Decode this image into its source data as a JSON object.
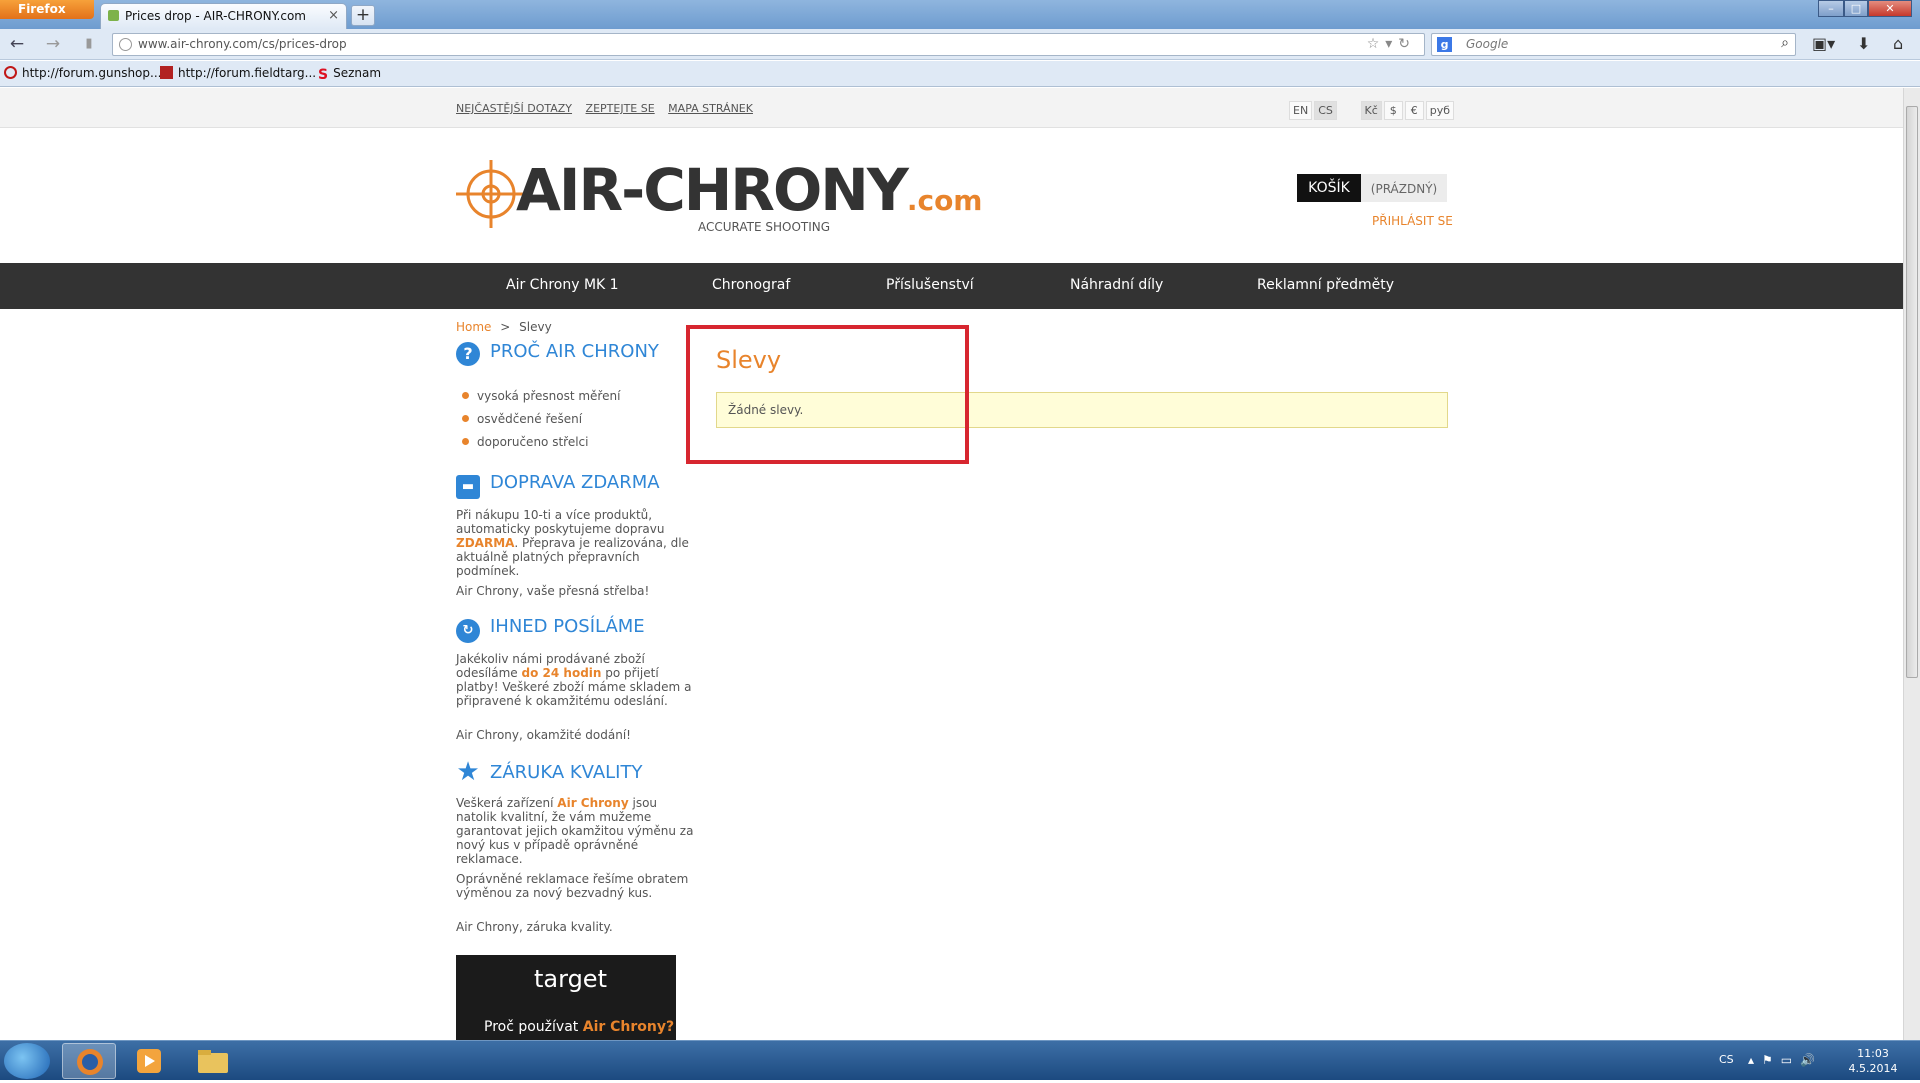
{
  "browser": {
    "app_menu": "Firefox",
    "tab_title": "Prices drop - AIR-CHRONY.com",
    "url": "www.air-chrony.com/cs/prices-drop",
    "search_placeholder": "Google",
    "bookmarks": [
      "http://forum.gunshop...",
      "http://forum.fieldtarg...",
      "Seznam"
    ]
  },
  "site": {
    "top_links": [
      "NEJČASTĚJŠÍ DOTAZY",
      "ZEPTEJTE SE",
      "MAPA STRÁNEK"
    ],
    "languages": [
      "EN",
      "CS"
    ],
    "currencies": [
      "Kč",
      "$",
      "€",
      "руб"
    ],
    "logo_text": "AIR-CHRONY",
    "logo_tld": ".com",
    "logo_sub": "ACCURATE SHOOTING",
    "cart_label": "KOŠÍK",
    "cart_value": "(PRÁZDNÝ)",
    "login": "PŘIHLÁSIT SE",
    "nav": [
      "Air Chrony MK 1",
      "Chronograf",
      "Příslušenství",
      "Náhradní díly",
      "Reklamní předměty"
    ],
    "breadcrumb": {
      "home": "Home",
      "sep": ">",
      "current": "Slevy"
    },
    "content_title": "Slevy",
    "content_message": "Žádné slevy."
  },
  "sidebar": {
    "why_title": "PROČ AIR CHRONY",
    "why_items": [
      "vysoká přesnost měření",
      "osvědčené řešení",
      "doporučeno střelci"
    ],
    "shipping_title": "DOPRAVA ZDARMA",
    "shipping_text_1": "Při nákupu 10-ti a více produktů, automaticky poskytujeme dopravu",
    "shipping_highlight": "ZDARMA",
    "shipping_text_2": ". Přeprava je realizována, dle aktuálně platných přepravních podmínek.",
    "shipping_tagline": "Air Chrony, vaše přesná střelba!",
    "dispatch_title": "IHNED POSÍLÁME",
    "dispatch_text_1": "Jakékoliv námi prodávané zboží odesíláme",
    "dispatch_highlight": "do 24 hodin",
    "dispatch_text_2": "po přijetí platby! Veškeré zboží máme skladem a připravené k okamžitému odeslání.",
    "dispatch_tagline": "Air Chrony, okamžité dodání!",
    "quality_title": "ZÁRUKA KVALITY",
    "quality_text_1": "Veškerá zařízení",
    "quality_highlight": "Air Chrony",
    "quality_text_2": "jsou natolik kvalitní, že vám mužeme garantovat jejich okamžitou výměnu za nový kus v případě oprávněné reklamace.",
    "quality_text_3": "Oprávněné reklamace řešíme obratem výměnou za nový bezvadný kus.",
    "quality_tagline": "Air Chrony, záruka kvality.",
    "banner_logo": "target",
    "banner_text_1": "Proč používat",
    "banner_text_2": "Air Chrony?"
  },
  "taskbar": {
    "lang": "CS",
    "time": "11:03",
    "date": "4.5.2014"
  },
  "colors": {
    "accent": "#e8842c",
    "blue": "#2f86d6",
    "nav_bg": "#333333",
    "highlight_box": "#d7262f"
  }
}
